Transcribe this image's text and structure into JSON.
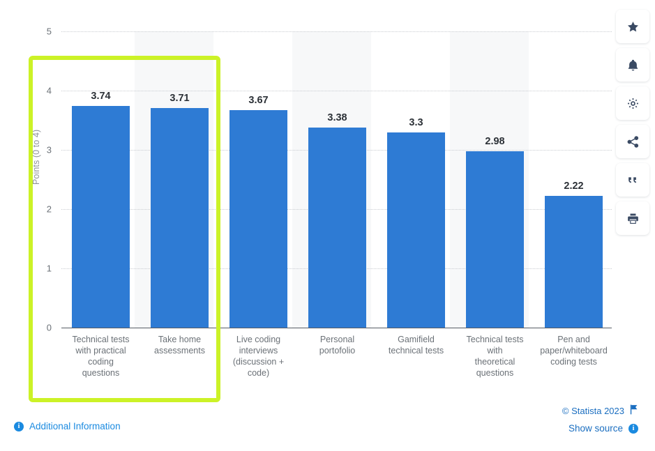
{
  "chart_data": {
    "type": "bar",
    "title": "",
    "xlabel": "",
    "ylabel": "Points (0 to 4)",
    "ylim": [
      0,
      5
    ],
    "yticks": [
      "0",
      "1",
      "2",
      "3",
      "4",
      "5"
    ],
    "grid": true,
    "legend": false,
    "orientation": "vertical",
    "bar_color": "#2e7bd4",
    "categories": [
      "Technical tests with practical coding questions",
      "Take home assessments",
      "Live coding interviews (discussion + code)",
      "Personal portofolio",
      "Gamifield technical tests",
      "Technical tests with theoretical questions",
      "Pen and paper/whiteboard coding tests"
    ],
    "category_lines": [
      [
        "Technical tests",
        "with practical",
        "coding",
        "questions"
      ],
      [
        "Take home",
        "assessments"
      ],
      [
        "Live coding",
        "interviews",
        "(discussion +",
        "code)"
      ],
      [
        "Personal",
        "portofolio"
      ],
      [
        "Gamifield",
        "technical tests"
      ],
      [
        "Technical tests",
        "with",
        "theoretical",
        "questions"
      ],
      [
        "Pen and",
        "paper/whiteboard",
        "coding tests"
      ]
    ],
    "values": [
      3.74,
      3.71,
      3.67,
      3.38,
      3.3,
      2.98,
      2.22
    ],
    "value_labels": [
      "3.74",
      "3.71",
      "3.67",
      "3.38",
      "3.3",
      "2.98",
      "2.22"
    ]
  },
  "annotation": {
    "highlight_color": "#ccf227",
    "highlight_covers": [
      "Technical tests with practical coding questions",
      "Take home assessments"
    ]
  },
  "toolbar": {
    "items": [
      {
        "icon": "star-icon",
        "label": "Favorite"
      },
      {
        "icon": "bell-icon",
        "label": "Notify"
      },
      {
        "icon": "gear-icon",
        "label": "Settings"
      },
      {
        "icon": "share-icon",
        "label": "Share"
      },
      {
        "icon": "quote-icon",
        "label": "Cite"
      },
      {
        "icon": "print-icon",
        "label": "Print"
      }
    ]
  },
  "footer": {
    "copyright": "© Statista 2023",
    "show_source": "Show source",
    "additional_information": "Additional Information",
    "link_color": "#1a6ec0"
  }
}
